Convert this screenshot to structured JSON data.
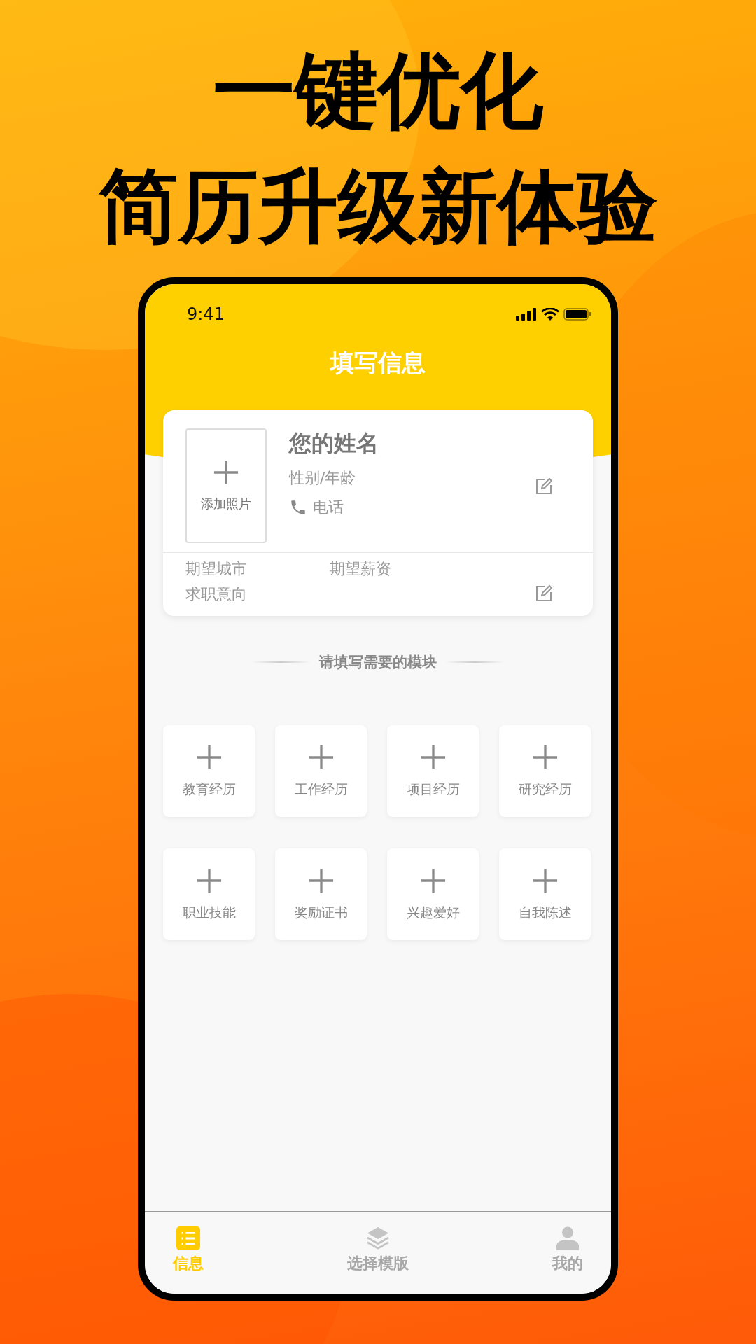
{
  "headline": [
    "一键优化",
    "简历升级新体验"
  ],
  "status_bar": {
    "time": "9:41"
  },
  "header": {
    "title": "填写信息"
  },
  "profile_card": {
    "photo_label": "添加照片",
    "name": "您的姓名",
    "gender_age": "性别/年龄",
    "phone": "电话",
    "expected_city": "期望城市",
    "expected_salary": "期望薪资",
    "job_intention": "求职意向"
  },
  "section_title": "请填写需要的模块",
  "modules": [
    {
      "label": "教育经历"
    },
    {
      "label": "工作经历"
    },
    {
      "label": "项目经历"
    },
    {
      "label": "研究经历"
    },
    {
      "label": "职业技能"
    },
    {
      "label": "奖励证书"
    },
    {
      "label": "兴趣爱好"
    },
    {
      "label": "自我陈述"
    }
  ],
  "tab_bar": [
    {
      "kind": "list",
      "label": "信息",
      "selected": true
    },
    {
      "kind": "layers",
      "label": "选择模版",
      "selected": false
    },
    {
      "kind": "person",
      "label": "我的",
      "selected": false
    }
  ]
}
